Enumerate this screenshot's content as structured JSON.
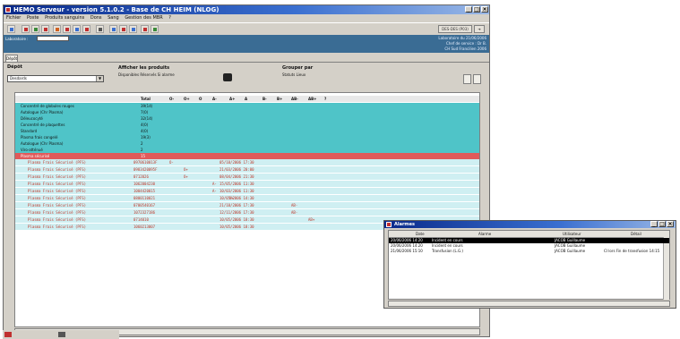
{
  "app": {
    "title": "HEMO Serveur - version 5.1.0.2 - Base de CH HEIM (NLOG)"
  },
  "menu": [
    "Fichier",
    "Poste",
    "Produits sanguins",
    "Dons",
    "Sang",
    "Gestion des MBR",
    "?"
  ],
  "nav": {
    "badge_label": "DES-DES (P03)"
  },
  "info": {
    "lab_label": "Laboratoire :",
    "lines": [
      "Laboratoire du 21/06/2006",
      "Chef de service : Dr B.",
      "CH Sud Francilien 2006"
    ]
  },
  "tab": {
    "label": "Dépôt"
  },
  "filters": {
    "depot_label": "Dépôt",
    "depot_value": "Desdards",
    "show_label": "Afficher les produits",
    "show_opts": "Disponibles  Réservés  Si alarme",
    "group_label": "Grouper par",
    "group_opts": "Statuts  Lieux"
  },
  "grid": {
    "cols": [
      "Total",
      "O-",
      "O+",
      "O",
      "A-",
      "A+",
      "A",
      "B-",
      "B+",
      "AB-",
      "AB+",
      "?"
    ],
    "rows": [
      {
        "label": "Concentré de globules rouges",
        "total": "39(14)",
        "style": "t"
      },
      {
        "label": "Autologue (Chr Plasma)",
        "total": "7(0)",
        "style": "t"
      },
      {
        "label": "Déleucocyté",
        "total": "32(14)",
        "style": "t"
      },
      {
        "label": "Concentré de plaquettes",
        "total": "4(0)",
        "style": "t"
      },
      {
        "label": "Standard",
        "total": "4(0)",
        "style": "t"
      },
      {
        "label": "Plasma frais congelé",
        "total": "19(3)",
        "style": "t"
      },
      {
        "label": "Autologue (Chr Plasma)",
        "total": "2",
        "style": "t"
      },
      {
        "label": "Viro-atténué",
        "total": "2",
        "style": "t"
      },
      {
        "label": "Plasma sécurisé",
        "total": "15",
        "style": "r"
      }
    ],
    "details": [
      {
        "name": "Plasma Frais Sécurisé (PFS)",
        "num": "0970610013F",
        "grp": "O-",
        "date": "05/10/2006 17:30"
      },
      {
        "name": "Plasma Frais Sécurisé (PFS)",
        "num": "0983420095F",
        "grp": "O+",
        "date": "21/03/2006 20:00"
      },
      {
        "name": "Plasma Frais Sécurisé (PFS)",
        "num": "0712026",
        "grp": "O+",
        "date": "08/04/2006 21:30"
      },
      {
        "name": "Plasma Frais Sécurisé (PFS)",
        "num": "1062004230",
        "grp": "A-",
        "date": "15/05/2006 11:30"
      },
      {
        "name": "Plasma Frais Sécurisé (PFS)",
        "num": "1004420015",
        "grp": "A-",
        "date": "10/03/2006 11:30"
      },
      {
        "name": "Plasma Frais Sécurisé (PFS)",
        "num": "0800110021",
        "grp": "A+",
        "date": "10/05/2006 14:30"
      },
      {
        "name": "Plasma Frais Sécurisé (PFS)",
        "num": "0700540167",
        "grp": "AB-",
        "date": "21/10/2006 17:30"
      },
      {
        "name": "Plasma Frais Sécurisé (PFS)",
        "num": "1072327186",
        "grp": "AB-",
        "date": "12/11/2006 17:30"
      },
      {
        "name": "Plasma Frais Sécurisé (PFS)",
        "num": "0714010",
        "grp": "AB+",
        "date": "10/05/2006 18:30"
      },
      {
        "name": "Plasma Frais Sécurisé (PFS)",
        "num": "1060213007",
        "grp": "",
        "date": "10/05/2006 18:30"
      }
    ]
  },
  "alarms": {
    "title": "Alarmes",
    "headers": [
      "Date",
      "Alarme",
      "Utilisateur",
      "Détail"
    ],
    "rows": [
      {
        "date": "20/06/2006 14:20",
        "alarm": "Incident en cours",
        "user": "JACOB Guillaume",
        "detail": ""
      },
      {
        "date": "20/06/2006 14:20",
        "alarm": "Incident en cours",
        "user": "JACOB Guillaume",
        "detail": ""
      },
      {
        "date": "21/06/2006 15:10",
        "alarm": "Transfusion (L.G.)",
        "user": "JACOB Guillaume",
        "detail": "CI lors Fin de transfusion 14:15"
      }
    ]
  },
  "colors": {
    "accent": "#4fc4c8",
    "alert": "#e05a5a",
    "title": "#0a2a8a"
  }
}
